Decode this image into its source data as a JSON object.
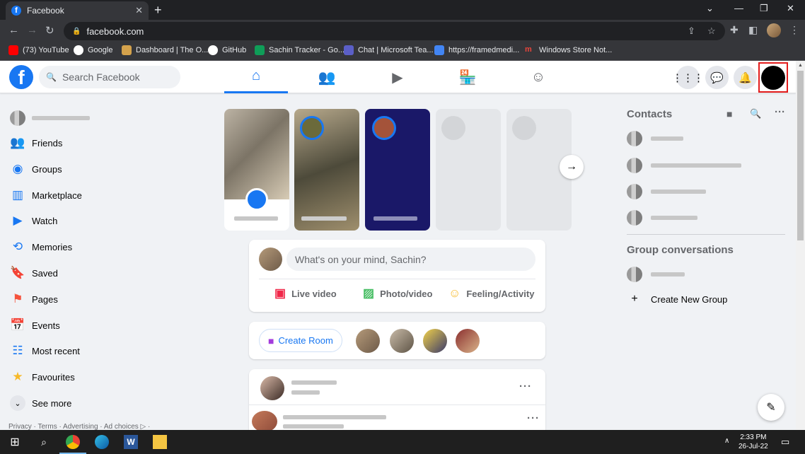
{
  "browser": {
    "tab_title": "Facebook",
    "tab_close": "✕",
    "new_tab": "+",
    "url": "facebook.com",
    "window_controls": [
      "⌄",
      "—",
      "❐",
      "✕"
    ],
    "bookmarks": [
      {
        "label": "(73) YouTube",
        "color": "#ff0000"
      },
      {
        "label": "Google",
        "color": "#ffffff"
      },
      {
        "label": "Dashboard | The O...",
        "color": "#d4a24c"
      },
      {
        "label": "GitHub",
        "color": "#ffffff"
      },
      {
        "label": "Sachin Tracker - Go...",
        "color": "#0f9d58"
      },
      {
        "label": "Chat | Microsoft Tea...",
        "color": "#5b5fc7"
      },
      {
        "label": "https://framedmedi...",
        "color": "#4285f4"
      },
      {
        "label": "Windows Store Not...",
        "color": "#e8453c"
      }
    ]
  },
  "fb_header": {
    "logo": "f",
    "search_placeholder": "Search Facebook",
    "brand_color": "#1877f2"
  },
  "left_sidebar": {
    "items": [
      {
        "label": "Friends",
        "icon": "friends-icon"
      },
      {
        "label": "Groups",
        "icon": "groups-icon"
      },
      {
        "label": "Marketplace",
        "icon": "marketplace-icon"
      },
      {
        "label": "Watch",
        "icon": "watch-icon"
      },
      {
        "label": "Memories",
        "icon": "memories-icon"
      },
      {
        "label": "Saved",
        "icon": "saved-icon"
      },
      {
        "label": "Pages",
        "icon": "pages-icon"
      },
      {
        "label": "Events",
        "icon": "events-icon"
      },
      {
        "label": "Most recent",
        "icon": "most-recent-icon"
      },
      {
        "label": "Favourites",
        "icon": "favourites-icon"
      },
      {
        "label": "See more",
        "icon": "chevron-down-icon"
      }
    ],
    "footer": "Privacy · Terms · Advertising · Ad choices ▷ ·"
  },
  "composer": {
    "placeholder": "What's on your mind, Sachin?",
    "actions": [
      {
        "label": "Live video",
        "color": "#f02849"
      },
      {
        "label": "Photo/video",
        "color": "#45bd62"
      },
      {
        "label": "Feeling/Activity",
        "color": "#f7b928"
      }
    ]
  },
  "rooms": {
    "create_room": "Create Room"
  },
  "right_sidebar": {
    "contacts_title": "Contacts",
    "group_conversations_title": "Group conversations",
    "create_new_group": "Create New Group"
  },
  "taskbar": {
    "time": "2:33 PM",
    "date": "26-Jul-22"
  }
}
